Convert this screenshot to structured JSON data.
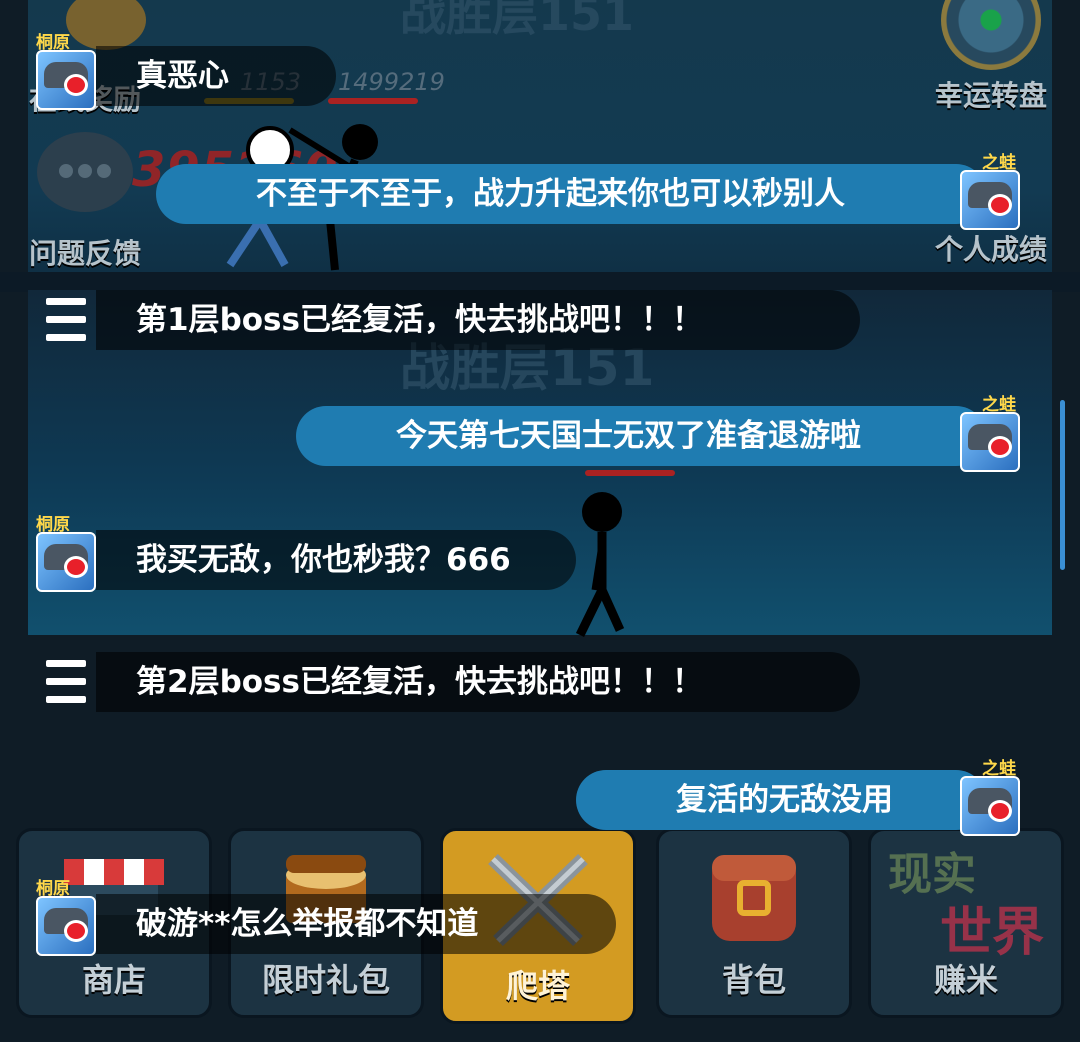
{
  "scene": {
    "floor_title_top": "战胜层151",
    "floor_title": "战胜层151",
    "stat_left": "1153",
    "stat_right": "1499219",
    "damage_number": "395260",
    "side_buttons": {
      "reward_label": "在线奖励",
      "feedback_label": "问题反馈",
      "lucky_wheel_label": "幸运转盘",
      "achievements_label": "个人成绩"
    }
  },
  "chat": {
    "messages": [
      {
        "sender": "桐原",
        "text": "真恶心",
        "side": "left"
      },
      {
        "sender": "之蛙",
        "text": "不至于不至于，战力升起来你也可以秒别人",
        "side": "right"
      },
      {
        "sender": "",
        "text": "第1层boss已经复活，快去挑战吧！！！",
        "side": "system"
      },
      {
        "sender": "之蛙",
        "text": "今天第七天国士无双了准备退游啦",
        "side": "right"
      },
      {
        "sender": "桐原",
        "text": "我买无敌，你也秒我？666",
        "side": "left"
      },
      {
        "sender": "",
        "text": "第2层boss已经复活，快去挑战吧！！！",
        "side": "system"
      },
      {
        "sender": "之蛙",
        "text": "复活的无敌没用",
        "side": "right"
      },
      {
        "sender": "桐原",
        "text": "破游**怎么举报都不知道",
        "side": "left"
      }
    ]
  },
  "bottom_nav": {
    "tabs": [
      {
        "label": "商店",
        "active": false
      },
      {
        "label": "限时礼包",
        "active": false
      },
      {
        "label": "爬塔",
        "active": true
      },
      {
        "label": "背包",
        "active": false
      },
      {
        "label": "赚米",
        "active": false
      }
    ],
    "promo_line1": "现实",
    "promo_line2": "世界"
  },
  "colors": {
    "name_tag": "#ffd84a",
    "bubble_right": "#1f7cb1",
    "active_tab": "#d39b22"
  }
}
